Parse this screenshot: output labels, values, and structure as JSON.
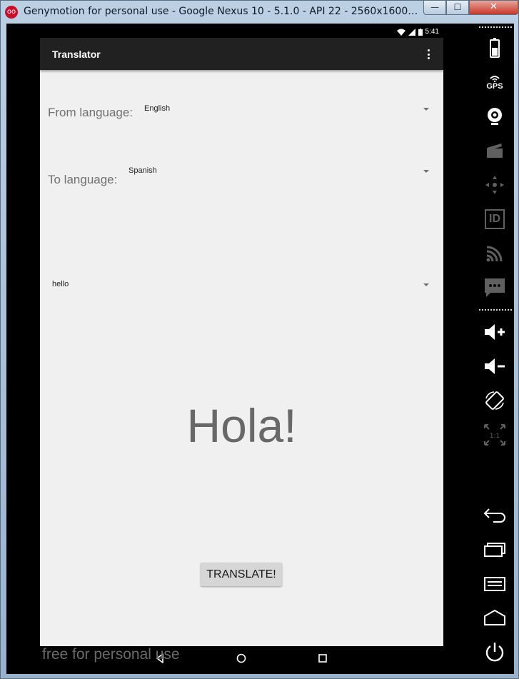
{
  "window": {
    "title": "Genymotion for personal use - Google Nexus 10 - 5.1.0 - API 22 - 2560x1600 (2560x...",
    "minimize_label": "—",
    "maximize_label": "☐",
    "close_label": "✕",
    "app_icon_label": "oo"
  },
  "statusbar": {
    "time": "5:41"
  },
  "app": {
    "title": "Translator",
    "from_label": "From language:",
    "from_value": "English",
    "to_label": "To language:",
    "to_value": "Spanish",
    "phrase_value": "hello",
    "result": "Hola!",
    "translate_button": "TRANSLATE!"
  },
  "watermark": "free for personal use",
  "sidebar": {
    "gps_label": "GPS",
    "pixel_perfect_label": "1:1",
    "id_label": "ID"
  },
  "colors": {
    "toolbar_icons": "#ffffff",
    "disabled_icons": "#606060"
  }
}
